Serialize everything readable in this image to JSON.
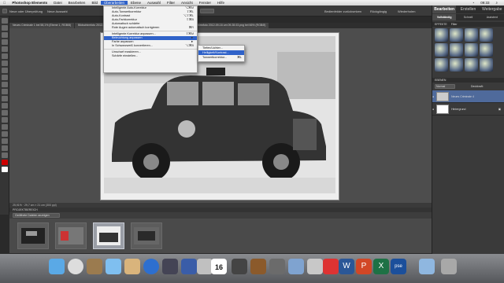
{
  "menubar": {
    "app": "Photoshop Elements",
    "items": [
      "Datei",
      "Bearbeiten",
      "Bild",
      "Überarbeiten",
      "Ebene",
      "Auswahl",
      "Filter",
      "Ansicht",
      "Fenster",
      "Hilfe"
    ],
    "active_index": 3,
    "clock": "09:33"
  },
  "options": {
    "undo": "Neue oder Überprüfung",
    "select_hint": "Neue Auswahl",
    "font_label": "Font",
    "top_right_1": "Bedienfelder zurücksetzen",
    "top_right_2": "Rückgängig",
    "top_right_3": "Wiederholen"
  },
  "tabs": [
    "Neues Criminale 1 bei 58,1% (Ebene 1, RGB/8)",
    "Bildschirmfoto 2012-...",
    "Neues Criminale 4 bei 25,6% (Neues Criminale 4, RGB/8)",
    "Bildschirmfoto 2012-09-16 um 09.28.03.png bei 66% (RGB/8)"
  ],
  "active_tab": 2,
  "menu": {
    "items": [
      {
        "label": "Intelligente Auto-Korrektur",
        "shortcut": "⌥⌘M",
        "highlighted": false
      },
      {
        "label": "Auto-Tonwertkorrektur",
        "shortcut": "⇧⌘L",
        "highlighted": false
      },
      {
        "label": "Auto-Kontrast",
        "shortcut": "⌥⇧⌘L",
        "highlighted": false
      },
      {
        "label": "Auto-Farbkorrektur",
        "shortcut": "⇧⌘B",
        "highlighted": false
      },
      {
        "label": "Automatisch schärfer",
        "shortcut": "",
        "highlighted": false
      },
      {
        "label": "Rote Augen automatisch korrigieren",
        "shortcut": "⌘R",
        "highlighted": false
      },
      {
        "sep": true
      },
      {
        "label": "Intelligente Korrektur anpassen...",
        "shortcut": "⇧⌘M",
        "highlighted": false
      },
      {
        "label": "Beleuchtung anpassen",
        "shortcut": "►",
        "highlighted": true
      },
      {
        "label": "Farbe anpassen",
        "shortcut": "►",
        "highlighted": false
      },
      {
        "label": "In Schwarzweiß konvertieren...",
        "shortcut": "⌥⌘B",
        "highlighted": false
      },
      {
        "sep": true
      },
      {
        "label": "Unscharf maskieren...",
        "shortcut": "",
        "highlighted": false
      },
      {
        "label": "Schärfe einstellen...",
        "shortcut": "",
        "highlighted": false
      }
    ]
  },
  "submenu": [
    {
      "label": "Tiefen/Lichter...",
      "shortcut": "",
      "highlighted": false
    },
    {
      "label": "Helligkeit/Kontrast...",
      "shortcut": "",
      "highlighted": true
    },
    {
      "label": "Tonwertkorrektur...",
      "shortcut": "⌘L",
      "highlighted": false
    }
  ],
  "status": "25,91% · 29,7 cm × 21 cm (300 ppi)",
  "bin": {
    "header": "PROJEKTBEREICH",
    "dropdown": "Geöffnete Dateien anzeigen",
    "thumbs": 4,
    "selected_thumb": 2
  },
  "rpanel": {
    "tabs": [
      "Bearbeiten",
      "Erstellen",
      "Weitergabe"
    ],
    "active_tab": 0,
    "modes": [
      "Vollständig",
      "Schnell",
      "Assistent"
    ],
    "effects_label": "EFFEKTE",
    "effects_sub": "Filter",
    "layers_label": "EBENEN",
    "blend": "Normal",
    "opacity_label": "Deckkraft:",
    "layers": [
      {
        "name": "Neues Criminale 4",
        "selected": true
      },
      {
        "name": "Hintergrund",
        "selected": false
      }
    ]
  },
  "dock_icons": [
    "finder",
    "clock",
    "contacts",
    "cloud",
    "ical",
    "appstore",
    "notes",
    "xcode",
    "preferences",
    "photos",
    "guitar",
    "folder",
    "word",
    "powerpoint",
    "excel",
    "pse",
    "terminal",
    "downloads",
    "trash"
  ],
  "dock_labels": {
    "pse": "pse",
    "calendar_day": "16"
  }
}
